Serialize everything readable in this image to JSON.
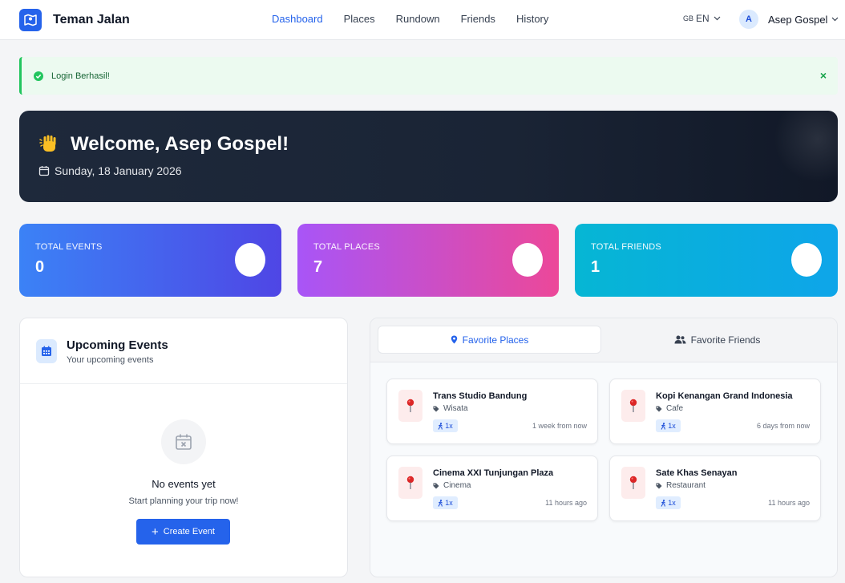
{
  "app": {
    "name": "Teman Jalan"
  },
  "nav": {
    "links": [
      "Dashboard",
      "Places",
      "Rundown",
      "Friends",
      "History"
    ],
    "active": "Dashboard",
    "language": {
      "flag": "GB",
      "code": "EN"
    },
    "user": {
      "initial": "A",
      "name": "Asep Gospel"
    }
  },
  "alert": {
    "message": "Login Berhasil!",
    "close": "×"
  },
  "welcome": {
    "title": "Welcome, Asep Gospel!",
    "date": "Sunday, 18 January 2026"
  },
  "stats": [
    {
      "label": "TOTAL EVENTS",
      "value": "0"
    },
    {
      "label": "TOTAL PLACES",
      "value": "7"
    },
    {
      "label": "TOTAL FRIENDS",
      "value": "1"
    }
  ],
  "events": {
    "title": "Upcoming Events",
    "subtitle": "Your upcoming events",
    "empty_title": "No events yet",
    "empty_subtitle": "Start planning your trip now!",
    "create_label": "Create Event"
  },
  "favorites": {
    "tabs": [
      "Favorite Places",
      "Favorite Friends"
    ],
    "active_tab": "Favorite Places",
    "places": [
      {
        "name": "Trans Studio Bandung",
        "category": "Wisata",
        "visits": "1x",
        "time": "1 week from now"
      },
      {
        "name": "Kopi Kenangan Grand Indonesia",
        "category": "Cafe",
        "visits": "1x",
        "time": "6 days from now"
      },
      {
        "name": "Cinema XXI Tunjungan Plaza",
        "category": "Cinema",
        "visits": "1x",
        "time": "11 hours ago"
      },
      {
        "name": "Sate Khas Senayan",
        "category": "Restaurant",
        "visits": "1x",
        "time": "11 hours ago"
      }
    ]
  },
  "colors": {
    "accent": "#2563eb",
    "success": "#22c55e",
    "events_card": "#4f46e5",
    "places_card": "#ec4899",
    "friends_card": "#06b6d4"
  }
}
